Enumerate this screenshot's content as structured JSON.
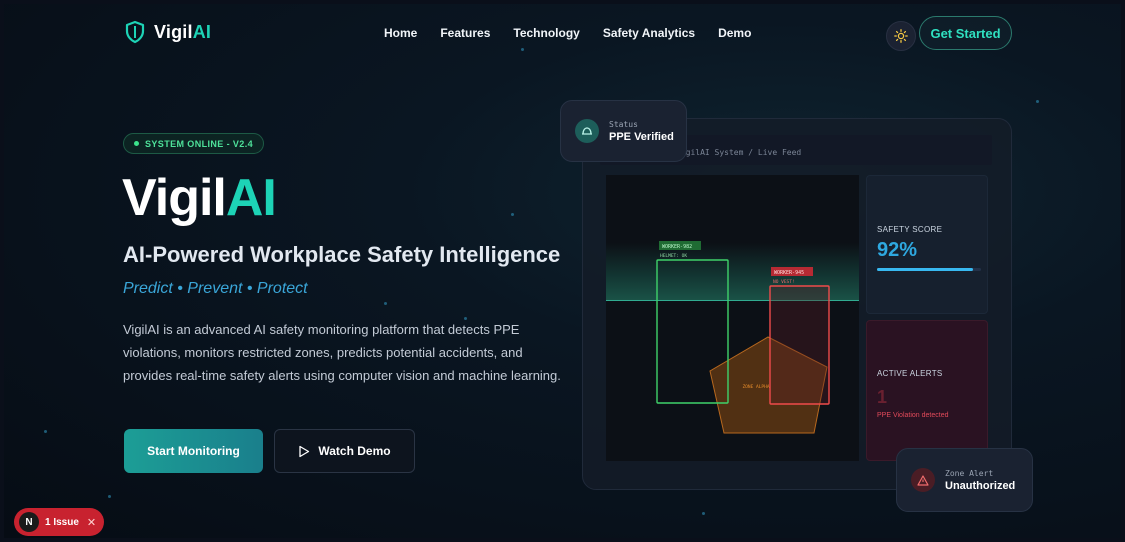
{
  "nav": {
    "logo_text": "Vigil",
    "logo_accent": "AI",
    "links": [
      "Home",
      "Features",
      "Technology",
      "Safety Analytics",
      "Demo"
    ],
    "cta_label": "Get Started",
    "theme_icon": "sun-icon"
  },
  "hero": {
    "badge": "SYSTEM ONLINE - V2.4",
    "title_main": "Vigil",
    "title_accent": "AI",
    "subtitle": "AI-Powered Workplace Safety Intelligence",
    "tagline": "Predict • Prevent • Protect",
    "description": "VigilAI is an advanced AI safety monitoring platform that detects PPE violations, monitors restricted zones, predicts potential accidents, and provides real-time safety alerts using computer vision and machine learning.",
    "primary_button": "Start Monitoring",
    "secondary_button": "Watch Demo"
  },
  "dashboard": {
    "window_title": "VigilAI System / Live Feed",
    "detections": [
      {
        "label": "WORKER-982",
        "status": "HELMET: OK",
        "color": "#3fd26a"
      },
      {
        "label": "WORKER-945",
        "status": "NO VEST!",
        "color": "#ef4b4b"
      }
    ],
    "zone_label": "ZONE ALPHA",
    "safety_score": {
      "label": "SAFETY SCORE",
      "value": "92%",
      "progress": 0.92
    },
    "active_alerts": {
      "label": "ACTIVE ALERTS",
      "value": "1",
      "message": "PPE Violation detected"
    },
    "status_card": {
      "label": "Status",
      "value": "PPE Verified"
    },
    "zone_card": {
      "label": "Zone Alert",
      "value": "Unauthorized"
    }
  },
  "dev_overlay": {
    "letter": "N",
    "label": "1 Issue"
  },
  "colors": {
    "accent": "#1dd3b6",
    "ok": "#3fd26a",
    "danger": "#ef4b4b",
    "info": "#2ea8e0"
  }
}
